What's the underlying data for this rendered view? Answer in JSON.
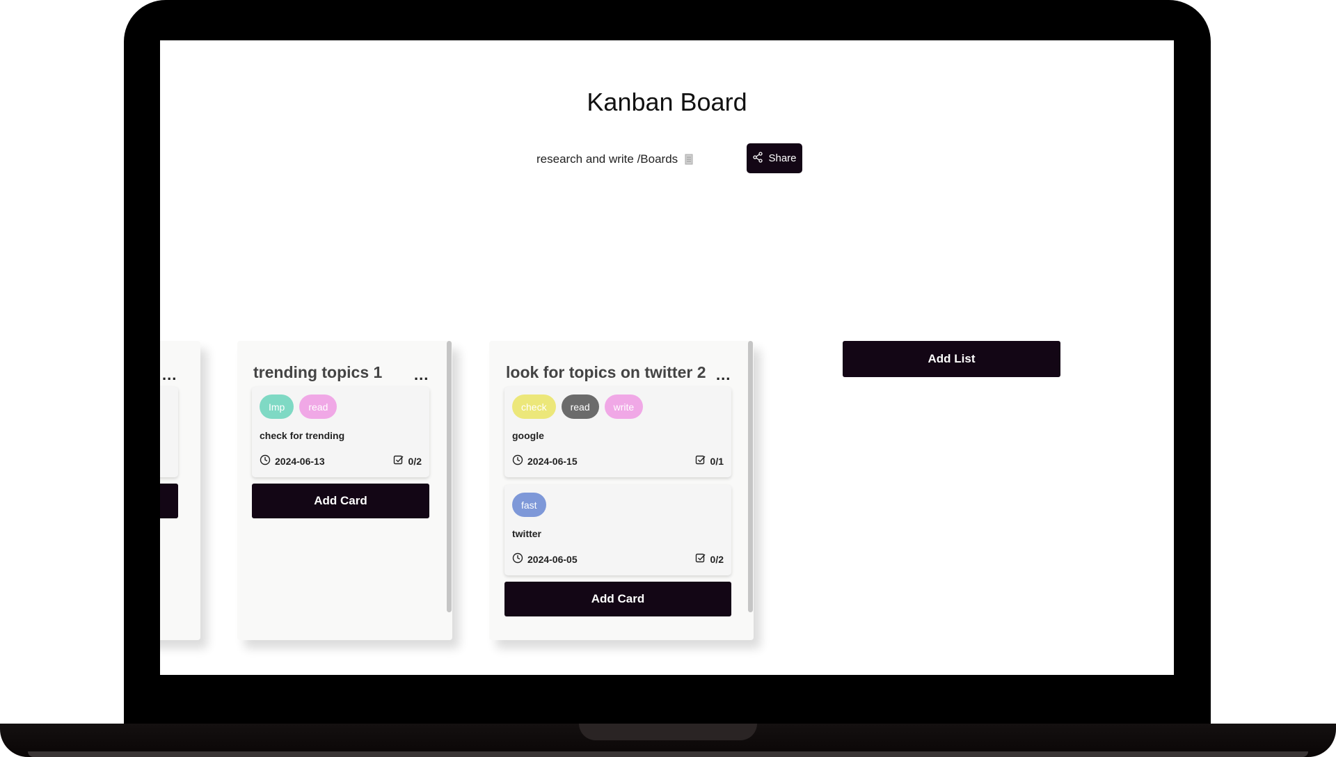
{
  "app": {
    "title": "Kanban Board",
    "breadcrumb": "research and write /Boards",
    "share_label": "Share",
    "add_list_label": "Add List"
  },
  "colors": {
    "primary": "#130615",
    "tag_imp": "#7fd9c4",
    "tag_read_pink": "#f0a8e6",
    "tag_check": "#ece77a",
    "tag_read_gray": "#6b6b6b",
    "tag_write": "#f0a8e6",
    "tag_fast": "#7e98d8"
  },
  "lists": [
    {
      "title": "",
      "menu": "...",
      "cards": [],
      "add_card_label": ""
    },
    {
      "title": "trending topics  1",
      "menu": "...",
      "cards": [
        {
          "tags": [
            {
              "label": "Imp"
            },
            {
              "label": "read"
            }
          ],
          "title": "check for trending",
          "date": "2024-06-13",
          "tasks": "0/2"
        }
      ],
      "add_card_label": "Add Card"
    },
    {
      "title": "look for topics on twitter  2",
      "menu": "...",
      "cards": [
        {
          "tags": [
            {
              "label": "check"
            },
            {
              "label": "read"
            },
            {
              "label": "write"
            }
          ],
          "title": "google",
          "date": "2024-06-15",
          "tasks": "0/1"
        },
        {
          "tags": [
            {
              "label": "fast"
            }
          ],
          "title": "twitter",
          "date": "2024-06-05",
          "tasks": "0/2"
        }
      ],
      "add_card_label": "Add Card"
    }
  ]
}
